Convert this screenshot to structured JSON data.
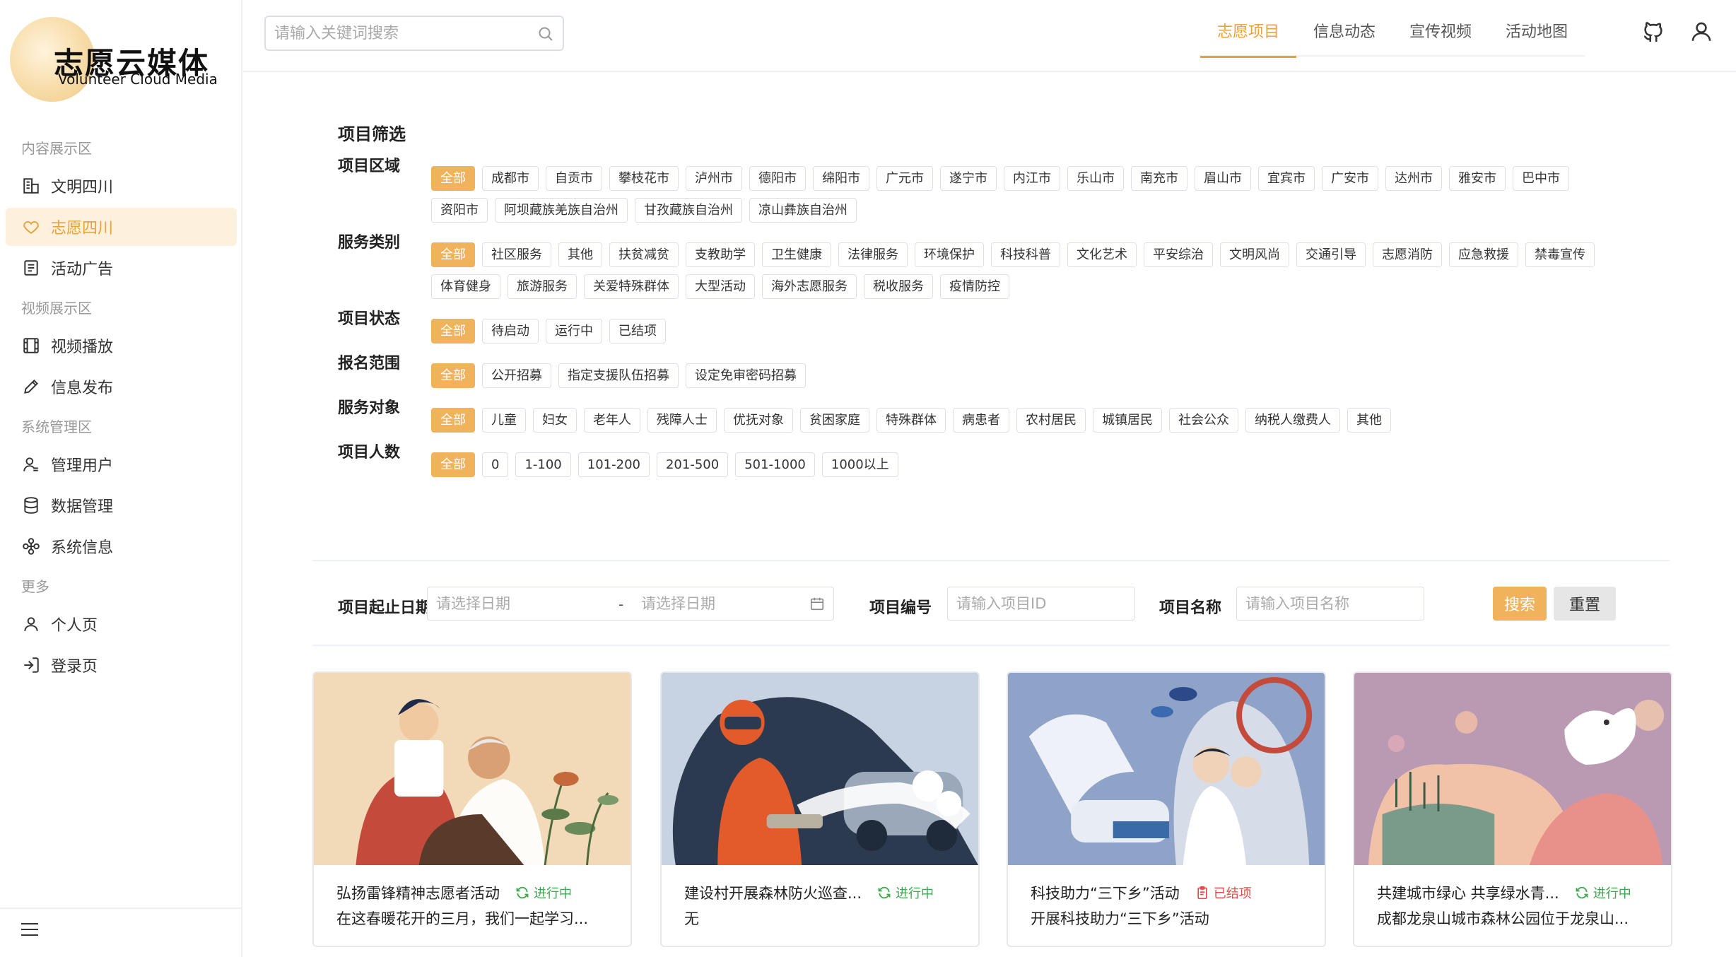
{
  "logo": {
    "title": "志愿云媒体",
    "subtitle": "Volunteer Cloud Media"
  },
  "sidebar": {
    "sections": [
      {
        "title": "内容展示区",
        "items": [
          {
            "label": "文明四川",
            "icon": "building-icon",
            "active": false
          },
          {
            "label": "志愿四川",
            "icon": "heart-icon",
            "active": true
          },
          {
            "label": "活动广告",
            "icon": "document-icon",
            "active": false
          }
        ]
      },
      {
        "title": "视频展示区",
        "items": [
          {
            "label": "视频播放",
            "icon": "film-icon",
            "active": false
          },
          {
            "label": "信息发布",
            "icon": "pencil-icon",
            "active": false
          }
        ]
      },
      {
        "title": "系统管理区",
        "items": [
          {
            "label": "管理用户",
            "icon": "user-manage-icon",
            "active": false
          },
          {
            "label": "数据管理",
            "icon": "database-icon",
            "active": false
          },
          {
            "label": "系统信息",
            "icon": "system-icon",
            "active": false
          }
        ]
      },
      {
        "title": "更多",
        "items": [
          {
            "label": "个人页",
            "icon": "user-icon",
            "active": false
          },
          {
            "label": "登录页",
            "icon": "login-icon",
            "active": false
          }
        ]
      }
    ]
  },
  "header": {
    "search_placeholder": "请输入关键词搜索",
    "tabs": [
      {
        "label": "志愿项目",
        "active": true
      },
      {
        "label": "信息动态",
        "active": false
      },
      {
        "label": "宣传视频",
        "active": false
      },
      {
        "label": "活动地图",
        "active": false
      }
    ]
  },
  "filters": {
    "title": "项目筛选",
    "rows": [
      {
        "label": "项目区域",
        "tags": [
          "全部",
          "成都市",
          "自贡市",
          "攀枝花市",
          "泸州市",
          "德阳市",
          "绵阳市",
          "广元市",
          "遂宁市",
          "内江市",
          "乐山市",
          "南充市",
          "眉山市",
          "宜宾市",
          "广安市",
          "达州市",
          "雅安市",
          "巴中市",
          "资阳市",
          "阿坝藏族羌族自治州",
          "甘孜藏族自治州",
          "凉山彝族自治州"
        ]
      },
      {
        "label": "服务类别",
        "tags": [
          "全部",
          "社区服务",
          "其他",
          "扶贫减贫",
          "支教助学",
          "卫生健康",
          "法律服务",
          "环境保护",
          "科技科普",
          "文化艺术",
          "平安综治",
          "文明风尚",
          "交通引导",
          "志愿消防",
          "应急救援",
          "禁毒宣传",
          "体育健身",
          "旅游服务",
          "关爱特殊群体",
          "大型活动",
          "海外志愿服务",
          "税收服务",
          "疫情防控"
        ]
      },
      {
        "label": "项目状态",
        "tags": [
          "全部",
          "待启动",
          "运行中",
          "已结项"
        ]
      },
      {
        "label": "报名范围",
        "tags": [
          "全部",
          "公开招募",
          "指定支援队伍招募",
          "设定免审密码招募"
        ]
      },
      {
        "label": "服务对象",
        "tags": [
          "全部",
          "儿童",
          "妇女",
          "老年人",
          "残障人士",
          "优抚对象",
          "贫困家庭",
          "特殊群体",
          "病患者",
          "农村居民",
          "城镇居民",
          "社会公众",
          "纳税人缴费人",
          "其他"
        ]
      },
      {
        "label": "项目人数",
        "tags": [
          "全部",
          "0",
          "1-100",
          "101-200",
          "201-500",
          "501-1000",
          "1000以上"
        ]
      }
    ]
  },
  "search_form": {
    "date_label": "项目起止日期",
    "date_start_placeholder": "请选择日期",
    "date_separator": "-",
    "date_end_placeholder": "请选择日期",
    "id_label": "项目编号",
    "id_placeholder": "请输入项目ID",
    "name_label": "项目名称",
    "name_placeholder": "请输入项目名称",
    "search_button": "搜索",
    "reset_button": "重置"
  },
  "cards": [
    {
      "title": "弘扬雷锋精神志愿者活动",
      "status": "进行中",
      "status_type": "ongoing",
      "desc": "在这春暖花开的三月，我们一起学习...",
      "image": "barber-illustration"
    },
    {
      "title": "建设村开展森林防火巡查...",
      "status": "进行中",
      "status_type": "ongoing",
      "desc": "无",
      "image": "firefighter-illustration"
    },
    {
      "title": "科技助力“三下乡”活动",
      "status": "已结项",
      "status_type": "done",
      "desc": "开展科技助力“三下乡”活动",
      "image": "science-illustration"
    },
    {
      "title": "共建城市绿心 共享绿水青...",
      "status": "进行中",
      "status_type": "ongoing",
      "desc": "成都龙泉山城市森林公园位于龙泉山...",
      "image": "dove-illustration"
    }
  ],
  "colors": {
    "accent": "#f0b25a",
    "accent_text": "#e8a23c",
    "ongoing": "#3da94f",
    "done": "#e84a4a"
  }
}
